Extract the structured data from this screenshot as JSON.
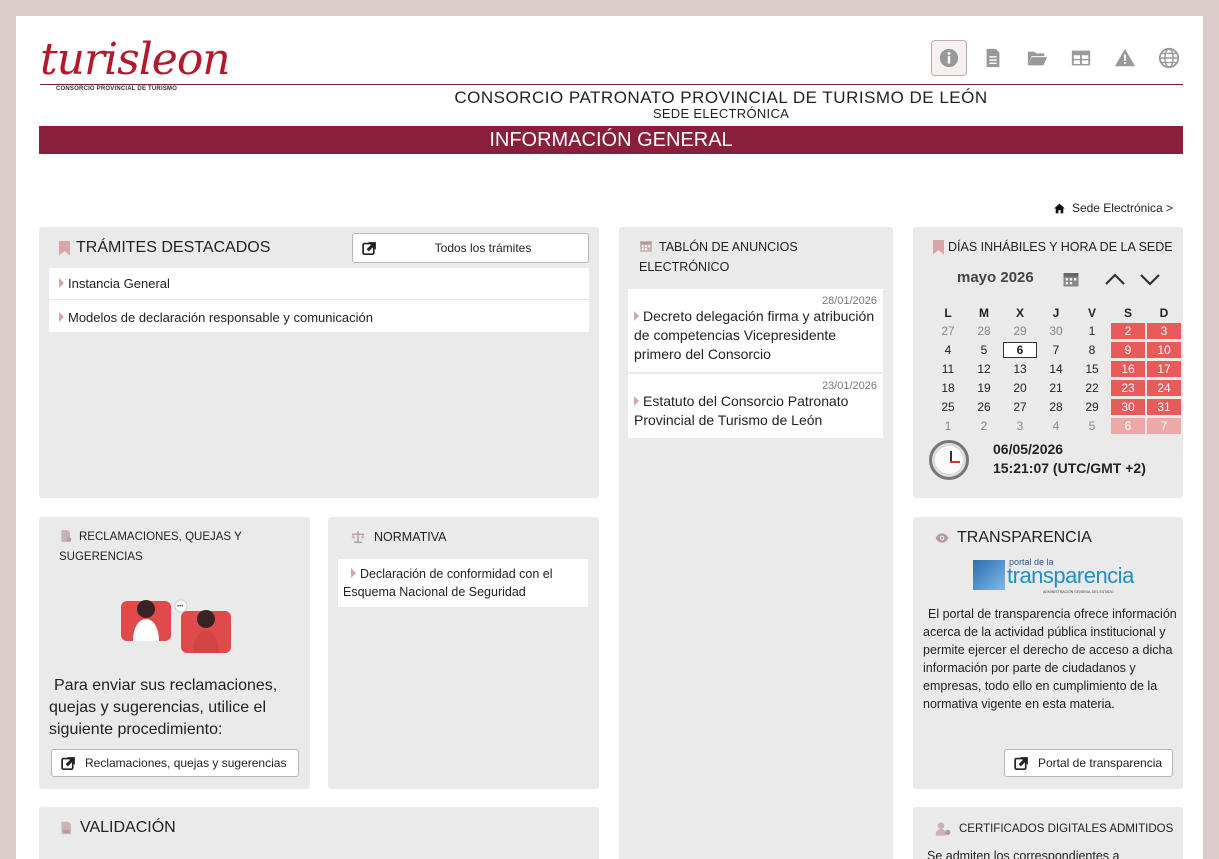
{
  "header": {
    "logo_text": "turisleon",
    "logo_sub": "CONSORCIO PROVINCIAL DE TURISMO",
    "org_title": "CONSORCIO PATRONATO PROVINCIAL DE TURISMO DE LEÓN",
    "org_subtitle": "SEDE ELECTRÓNICA",
    "banner": "INFORMACIÓN GENERAL",
    "icons": [
      "info-icon",
      "document-icon",
      "folder-open-icon",
      "table-icon",
      "warning-icon",
      "globe-icon"
    ]
  },
  "breadcrumb": {
    "label": "Sede Electrónica >"
  },
  "tramites": {
    "title": "TRÁMITES DESTACADOS",
    "all_button": "Todos los trámites",
    "items": [
      "Instancia General",
      "Modelos de declaración responsable y comunicación"
    ]
  },
  "tablon": {
    "title_line1": "TABLÓN DE ANUNCIOS",
    "title_line2": "ELECTRÓNICO",
    "items": [
      {
        "date": "28/01/2026",
        "text": "Decreto delegación firma y atribución de competencias Vicepresidente primero del Consorcio"
      },
      {
        "date": "23/01/2026",
        "text": "Estatuto del Consorcio Patronato Provincial de Turismo de León"
      }
    ]
  },
  "calendar": {
    "title": "DÍAS INHÁBILES Y HORA DE LA SEDE",
    "month": "mayo 2026",
    "weekdays": [
      "L",
      "M",
      "X",
      "J",
      "V",
      "S",
      "D"
    ],
    "weeks": [
      [
        "27",
        "28",
        "29",
        "30",
        "1",
        "2",
        "3"
      ],
      [
        "4",
        "5",
        "6",
        "7",
        "8",
        "9",
        "10"
      ],
      [
        "11",
        "12",
        "13",
        "14",
        "15",
        "16",
        "17"
      ],
      [
        "18",
        "19",
        "20",
        "21",
        "22",
        "23",
        "24"
      ],
      [
        "25",
        "26",
        "27",
        "28",
        "29",
        "30",
        "31"
      ],
      [
        "1",
        "2",
        "3",
        "4",
        "5",
        "6",
        "7"
      ]
    ],
    "date": "06/05/2026",
    "time": "15:21:07 (UTC/GMT +2)"
  },
  "reclamaciones": {
    "title_line1": "RECLAMACIONES, QUEJAS Y",
    "title_line2": "SUGERENCIAS",
    "text": "Para enviar sus reclamaciones, quejas y sugerencias, utilice el siguiente procedimiento:",
    "button": "Reclamaciones, quejas y sugerencias"
  },
  "normativa": {
    "title": "NORMATIVA",
    "items": [
      "Declaración de conformidad con el Esquema Nacional de Seguridad"
    ]
  },
  "transparencia": {
    "title": "TRANSPARENCIA",
    "logo_small": "portal de la",
    "logo_big": "transparencia",
    "logo_caption": "ADMINISTRACIÓN GENERAL DEL ESTADO",
    "text": "El portal de transparencia ofrece información acerca de la actividad pública institucional y permite ejercer el derecho de acceso a dicha información por parte de ciudadanos y empresas, todo ello en cumplimiento de la normativa vigente en esta materia.",
    "button": "Portal de transparencia"
  },
  "validacion": {
    "title": "VALIDACIÓN"
  },
  "certificados": {
    "title": "CERTIFICADOS DIGITALES ADMITIDOS",
    "text": "Se admiten los correspondientes a"
  },
  "colors": {
    "brand": "#8a1f3c",
    "holiday": "#e95a5a",
    "panel": "#eaeaea"
  }
}
